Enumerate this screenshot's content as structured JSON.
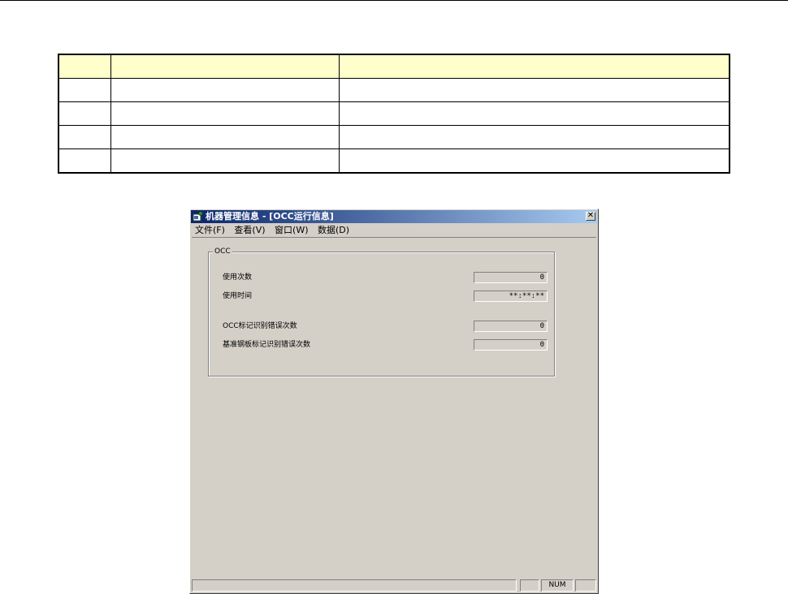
{
  "window": {
    "title": "机器管理信息 - [OCC运行信息]",
    "close_glyph": "✕",
    "icon": "app-icon"
  },
  "menu": {
    "items": [
      {
        "label": "文件(F)"
      },
      {
        "label": "查看(V)"
      },
      {
        "label": "窗口(W)"
      },
      {
        "label": "数据(D)"
      }
    ]
  },
  "group": {
    "title": "OCC",
    "fields": [
      {
        "label": "使用次数",
        "value": "0"
      },
      {
        "label": "使用时间",
        "value": "**:**:**"
      },
      {
        "label": "OCC标记识别错误次数",
        "value": "0"
      },
      {
        "label": "基准钢板标记识别错误次数",
        "value": "0"
      }
    ]
  },
  "status": {
    "pane1": "",
    "num": "NUM",
    "pane3": ""
  },
  "spec_table": {
    "header": [
      "",
      "",
      ""
    ],
    "rows": [
      [
        "",
        "",
        ""
      ],
      [
        "",
        "",
        ""
      ],
      [
        "",
        "",
        ""
      ],
      [
        "",
        "",
        ""
      ]
    ]
  },
  "colors": {
    "table_header": "#ffffcc",
    "window_face": "#d4d0c8",
    "titlebar_start": "#0a246a",
    "titlebar_end": "#a6caf0"
  }
}
